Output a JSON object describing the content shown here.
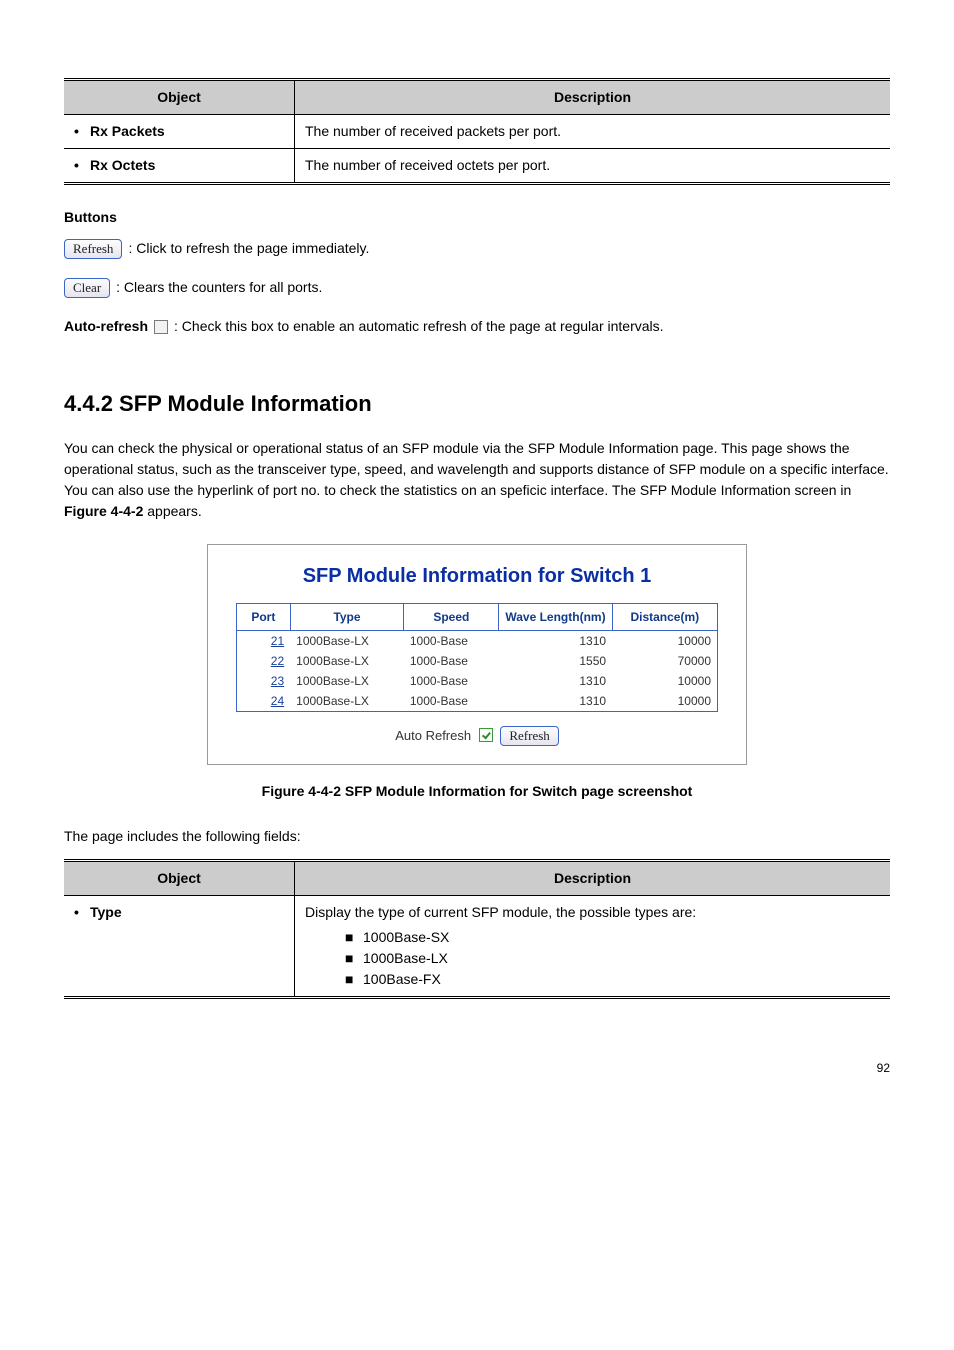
{
  "table1": {
    "head_obj": "Object",
    "head_desc": "Description",
    "rows": [
      {
        "obj": "Rx Packets",
        "desc": "The number of received packets per port."
      },
      {
        "obj": "Rx Octets",
        "desc": "The number of received octets per port."
      }
    ]
  },
  "buttons": {
    "heading": "Buttons",
    "refresh_label": "Refresh",
    "refresh_desc": ": Click to refresh the page immediately.",
    "clear_label": "Clear",
    "clear_desc": ": Clears the counters for all ports.",
    "auto_refresh_label": "Auto-refresh",
    "auto_refresh_desc": ": Check this box to enable an automatic refresh of the page at regular intervals."
  },
  "section_heading": "4.4.2 SFP Module Information",
  "intro_text": "You can check the physical or operational status of an SFP module via the SFP Module Information page. This page shows the operational status, such as the transceiver type, speed, and wavelength and supports distance of SFP module on a specific interface. You can also use the hyperlink of port no. to check the statistics on an speficic interface.",
  "intro_tail": "The SFP Module Information screen in ",
  "intro_fig_ref": "Figure 4-4-2",
  "intro_tail2": " appears.",
  "sfp_panel": {
    "title": "SFP Module Information for Switch 1",
    "columns": [
      "Port",
      "Type",
      "Speed",
      "Wave Length(nm)",
      "Distance(m)"
    ],
    "rows": [
      {
        "port": "21",
        "type": "1000Base-LX",
        "speed": "1000-Base",
        "wave": "1310",
        "dist": "10000"
      },
      {
        "port": "22",
        "type": "1000Base-LX",
        "speed": "1000-Base",
        "wave": "1550",
        "dist": "70000"
      },
      {
        "port": "23",
        "type": "1000Base-LX",
        "speed": "1000-Base",
        "wave": "1310",
        "dist": "10000"
      },
      {
        "port": "24",
        "type": "1000Base-LX",
        "speed": "1000-Base",
        "wave": "1310",
        "dist": "10000"
      }
    ],
    "auto_refresh_label": "Auto Refresh",
    "refresh_btn": "Refresh"
  },
  "fig_caption": "Figure 4-4-2 SFP Module Information for Switch page screenshot",
  "pre_table2": "The page includes the following fields:",
  "table2": {
    "head_obj": "Object",
    "head_desc": "Description",
    "type_label": "Type",
    "type_desc_lead": "Display the type of current SFP module, the possible types are:",
    "type_items": [
      "1000Base-SX",
      "1000Base-LX",
      "100Base-FX"
    ]
  },
  "page_number": "92"
}
